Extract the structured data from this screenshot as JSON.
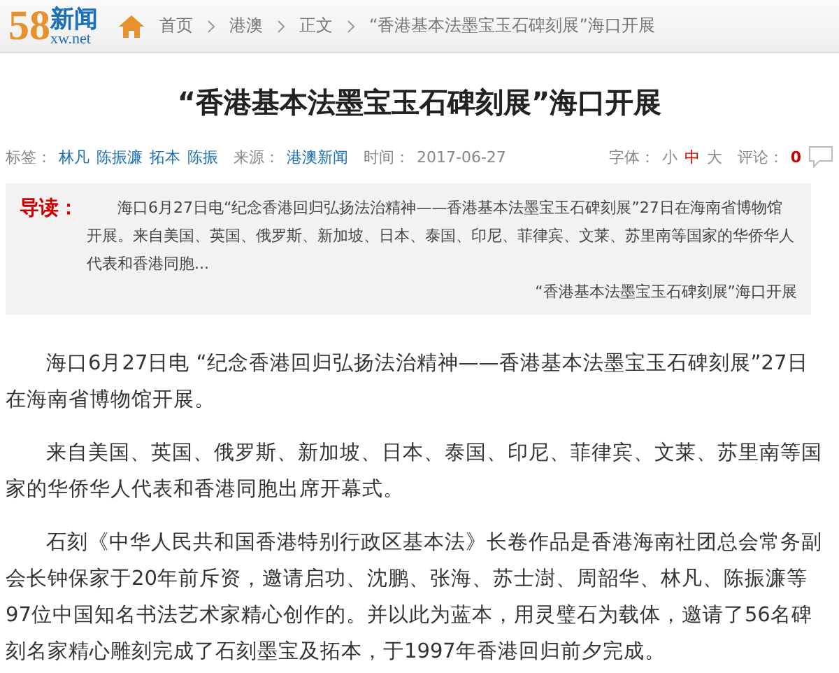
{
  "header": {
    "logo_number": "58",
    "logo_name": "新闻",
    "logo_domain": "xw.net",
    "breadcrumbs": [
      "首页",
      "港澳",
      "正文",
      "“香港基本法墨宝玉石碑刻展”海口开展"
    ]
  },
  "title": "“香港基本法墨宝玉石碑刻展”海口开展",
  "meta": {
    "tags_label": "标签：",
    "tags": [
      "林凡",
      "陈振濂",
      "拓本",
      "陈振"
    ],
    "source_label": "来源：",
    "source": "港澳新闻",
    "time_label": "时间：",
    "time": "2017-06-27",
    "font_label": "字体：",
    "font_sizes": [
      {
        "label": "小",
        "selected": false
      },
      {
        "label": "中",
        "selected": true
      },
      {
        "label": "大",
        "selected": false
      }
    ],
    "comments_label": "评论：",
    "comments": "0"
  },
  "summary": {
    "label": "导读：",
    "text": "海口6月27日电“纪念香港回归弘扬法治精神——香港基本法墨宝玉石碑刻展”27日在海南省博物馆开展。来自美国、英国、俄罗斯、新加坡、日本、泰国、印尼、菲律宾、文莱、苏里南等国家的华侨华人代表和香港同胞...",
    "link": "“香港基本法墨宝玉石碑刻展”海口开展"
  },
  "paragraphs": [
    "海口6月27日电 “纪念香港回归弘扬法治精神——香港基本法墨宝玉石碑刻展”27日在海南省博物馆开展。",
    "来自美国、英国、俄罗斯、新加坡、日本、泰国、印尼、菲律宾、文莱、苏里南等国家的华侨华人代表和香港同胞出席开幕式。",
    "石刻《中华人民共和国香港特别行政区基本法》长卷作品是香港海南社团总会常务副会长钟保家于20年前斥资，邀请启功、沈鹏、张海、苏士澍、周韶华、林凡、陈振濂等97位中国知名书法艺术家精心创作的。并以此为蓝本，用灵璧石为载体，邀请了56名碑刻名家精心雕刻完成了石刻墨宝及拓本，于1997年香港回归前夕完成。"
  ]
}
